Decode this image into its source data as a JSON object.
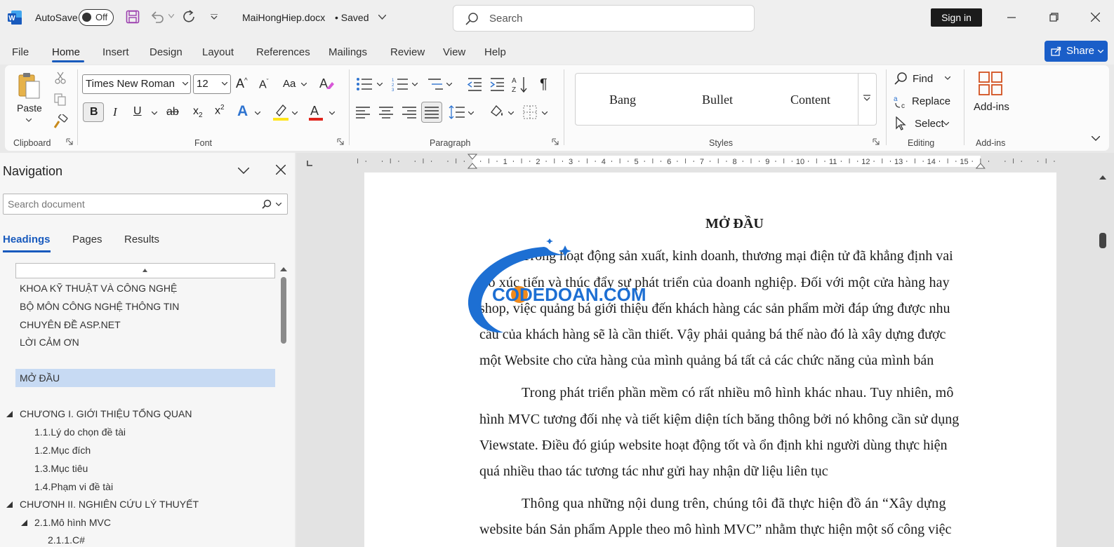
{
  "titlebar": {
    "autosave_label": "AutoSave",
    "autosave_state": "Off",
    "filename": "MaiHongHiep.docx",
    "save_status": "• Saved",
    "search_placeholder": "Search",
    "signin_label": "Sign in"
  },
  "menu": {
    "tabs": [
      "File",
      "Home",
      "Insert",
      "Design",
      "Layout",
      "References",
      "Mailings",
      "Review",
      "View",
      "Help"
    ],
    "active": "Home",
    "share_label": "Share"
  },
  "ribbon": {
    "clipboard": {
      "paste_label": "Paste",
      "group_label": "Clipboard"
    },
    "font": {
      "font_name": "Times New Roman",
      "font_size": "12",
      "group_label": "Font",
      "change_case": "Aa"
    },
    "paragraph": {
      "group_label": "Paragraph"
    },
    "styles": {
      "items": [
        "Bang",
        "Bullet",
        "Content"
      ],
      "group_label": "Styles"
    },
    "editing": {
      "find_label": "Find",
      "replace_label": "Replace",
      "select_label": "Select",
      "group_label": "Editing"
    },
    "addins": {
      "addins_label": "Add-ins",
      "group_label": "Add-ins"
    }
  },
  "navigation": {
    "title": "Navigation",
    "search_placeholder": "Search document",
    "tabs": [
      "Headings",
      "Pages",
      "Results"
    ],
    "active_tab": "Headings",
    "headings": [
      "KHOA KỸ THUẬT VÀ CÔNG NGHỆ",
      "BỘ MÔN CÔNG NGHỆ THÔNG TIN",
      "CHUYÊN ĐỀ ASP.NET",
      "LỜI CẢM ƠN",
      "MỞ ĐẦU",
      "CHƯƠNG I. GIỚI THIỆU TỔNG QUAN",
      "1.1.Lý do chọn đề tài",
      "1.2.Mục đích",
      "1.3.Mục tiêu",
      "1.4.Phạm vi đề tài",
      "CHƯƠNH II. NGHIÊN CỨU LÝ THUYẾT",
      "2.1.Mô hình MVC",
      "2.1.1.C#"
    ],
    "selected_heading": "MỞ ĐẦU"
  },
  "ruler": {
    "ticks": [
      "1",
      "2",
      "3",
      "4",
      "5",
      "6",
      "7",
      "8",
      "9",
      "10",
      "11",
      "12",
      "13",
      "14",
      "15"
    ]
  },
  "document": {
    "title": "MỞ ĐẦU",
    "lines": [
      "Trong hoạt động sản xuất, kinh doanh, thương mại điện tử đã khẳng định vai",
      "trò xúc tiến và thúc đẩy sự phát triển của doanh nghiệp. Đối với một cửa hàng hay",
      "shop, việc quảng bá giới thiệu đến khách hàng các sản phẩm mời đáp ứng được nhu",
      "cầu của khách hàng sẽ là cần thiết. Vậy phải quảng bá thế nào đó là xây dựng được",
      "một Website cho cửa hàng của mình quảng bá tất cả các chức năng của mình bán",
      "Trong phát triển phần mềm có rất nhiều mô hình khác nhau. Tuy nhiên, mô",
      "hình MVC tương đối nhẹ và tiết kiệm diện tích băng thông bởi nó không cần sử dụng",
      "Viewstate. Điều đó giúp website hoạt động tốt và ổn định khi người dùng thực hiện",
      "quá nhiều thao tác tương tác như gửi hay nhận dữ liệu liên tục",
      "Thông qua những nội dung trên, chúng tôi đã thực hiện đồ án “Xây dựng",
      "website bán Sản phẩm Apple theo mô hình MVC” nhằm thực hiện một số công việc"
    ],
    "watermark": "CODEDOAN.COM"
  },
  "colors": {
    "accent": "#185abd",
    "share": "#1a5ec8",
    "selected": "#c7daf3",
    "watermark_blue": "#1d6fd3",
    "watermark_orange": "#f08a1c"
  }
}
